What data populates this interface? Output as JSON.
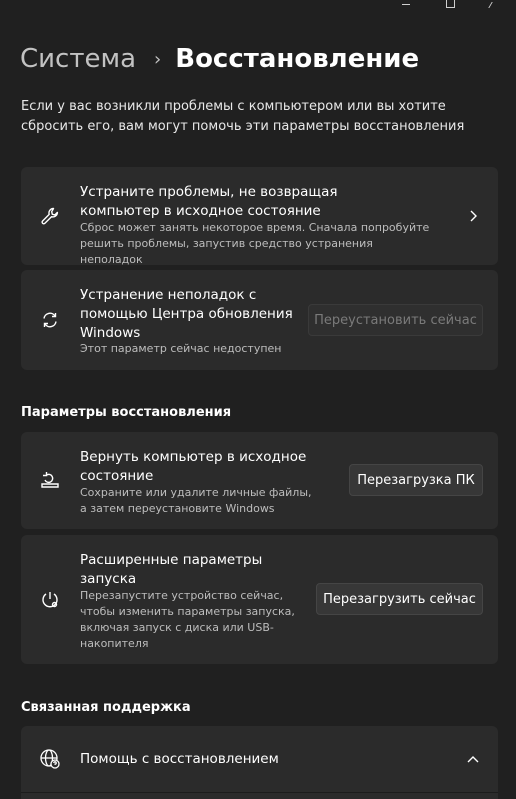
{
  "header": {
    "parent": "Система",
    "separator": "›",
    "current": "Восстановление"
  },
  "intro": "Если у вас возникли проблемы с компьютером или вы хотите сбросить его, вам могут помочь эти параметры восстановления",
  "cards": {
    "fix": {
      "icon": "wrench-icon",
      "title": "Устраните проблемы, не возвращая компьютер в исходное состояние",
      "desc": "Сброс может занять некоторое время. Сначала попробуйте решить проблемы, запустив средство устранения неполадок"
    },
    "update": {
      "icon": "sync-icon",
      "title": "Устранение неполадок с помощью Центра обновления Windows",
      "desc": "Этот параметр сейчас недоступен",
      "button": "Переустановить сейчас"
    }
  },
  "sections": {
    "recovery": "Параметры восстановления",
    "support": "Связанная поддержка"
  },
  "recovery": {
    "reset": {
      "icon": "reset-pc-icon",
      "title": "Вернуть компьютер в исходное состояние",
      "desc": "Сохраните или удалите личные файлы, а затем переустановите Windows",
      "button": "Перезагрузка ПК"
    },
    "advanced": {
      "icon": "advanced-startup-icon",
      "title": "Расширенные параметры запуска",
      "desc": "Перезапустите устройство сейчас, чтобы изменить параметры запуска, включая запуск с диска или USB-накопителя",
      "button": "Перезагрузить сейчас"
    }
  },
  "support": {
    "help": {
      "icon": "globe-help-icon",
      "title": "Помощь с восстановлением"
    }
  }
}
